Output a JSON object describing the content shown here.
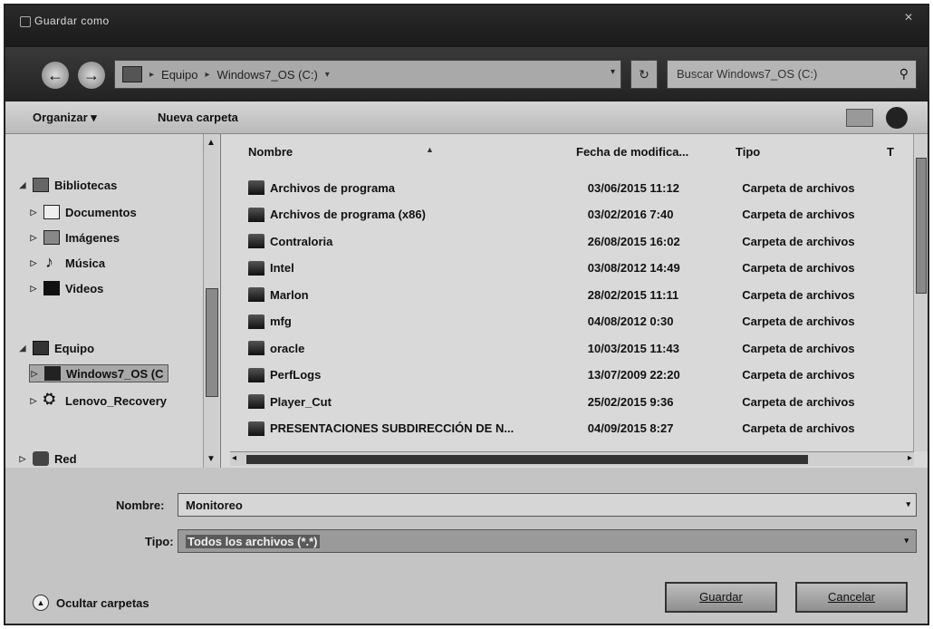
{
  "titlebar": {
    "title": "Guardar como",
    "close": "✕"
  },
  "nav": {
    "back": "←",
    "forward": "→",
    "breadcrumb": [
      "Equipo",
      "Windows7_OS (C:)"
    ],
    "refresh": "↻",
    "search_placeholder": "Buscar Windows7_OS (C:)"
  },
  "toolbar": {
    "organize": "Organizar ▾",
    "new_folder": "Nueva carpeta"
  },
  "sidebar": {
    "items": [
      {
        "label": "Bibliotecas",
        "icon": "library-icon",
        "arrow": "◢"
      },
      {
        "label": "Documentos",
        "icon": "documents-icon",
        "arrow": "▷"
      },
      {
        "label": "Imágenes",
        "icon": "pictures-icon",
        "arrow": "▷"
      },
      {
        "label": "Música",
        "icon": "music-icon",
        "arrow": "▷"
      },
      {
        "label": "Videos",
        "icon": "videos-icon",
        "arrow": "▷"
      },
      {
        "label": "Equipo",
        "icon": "computer-icon",
        "arrow": "◢"
      },
      {
        "label": "Windows7_OS (C",
        "icon": "drive-icon",
        "arrow": "▷"
      },
      {
        "label": "Lenovo_Recovery",
        "icon": "recovery-drive-icon",
        "arrow": "▷"
      },
      {
        "label": "Red",
        "icon": "network-icon",
        "arrow": "▷"
      }
    ]
  },
  "files": {
    "columns": {
      "name": "Nombre",
      "date": "Fecha de modifica...",
      "type": "Tipo",
      "extra": "T"
    },
    "rows": [
      {
        "name": "Archivos de programa",
        "date": "03/06/2015 11:12",
        "type": "Carpeta de archivos"
      },
      {
        "name": "Archivos de programa (x86)",
        "date": "03/02/2016 7:40",
        "type": "Carpeta de archivos"
      },
      {
        "name": "Contraloria",
        "date": "26/08/2015 16:02",
        "type": "Carpeta de archivos"
      },
      {
        "name": "Intel",
        "date": "03/08/2012 14:49",
        "type": "Carpeta de archivos"
      },
      {
        "name": "Marlon",
        "date": "28/02/2015 11:11",
        "type": "Carpeta de archivos"
      },
      {
        "name": "mfg",
        "date": "04/08/2012 0:30",
        "type": "Carpeta de archivos"
      },
      {
        "name": "oracle",
        "date": "10/03/2015 11:43",
        "type": "Carpeta de archivos"
      },
      {
        "name": "PerfLogs",
        "date": "13/07/2009 22:20",
        "type": "Carpeta de archivos"
      },
      {
        "name": "Player_Cut",
        "date": "25/02/2015 9:36",
        "type": "Carpeta de archivos"
      },
      {
        "name": "PRESENTACIONES SUBDIRECCIÓN DE N...",
        "date": "04/09/2015 8:27",
        "type": "Carpeta de archivos"
      }
    ]
  },
  "form": {
    "name_label": "Nombre:",
    "name_value": "Monitoreo",
    "type_label": "Tipo:",
    "type_value": "Todos los archivos (*.*)"
  },
  "footer": {
    "hide_folders": "Ocultar carpetas",
    "save": "Guardar",
    "cancel": "Cancelar"
  }
}
